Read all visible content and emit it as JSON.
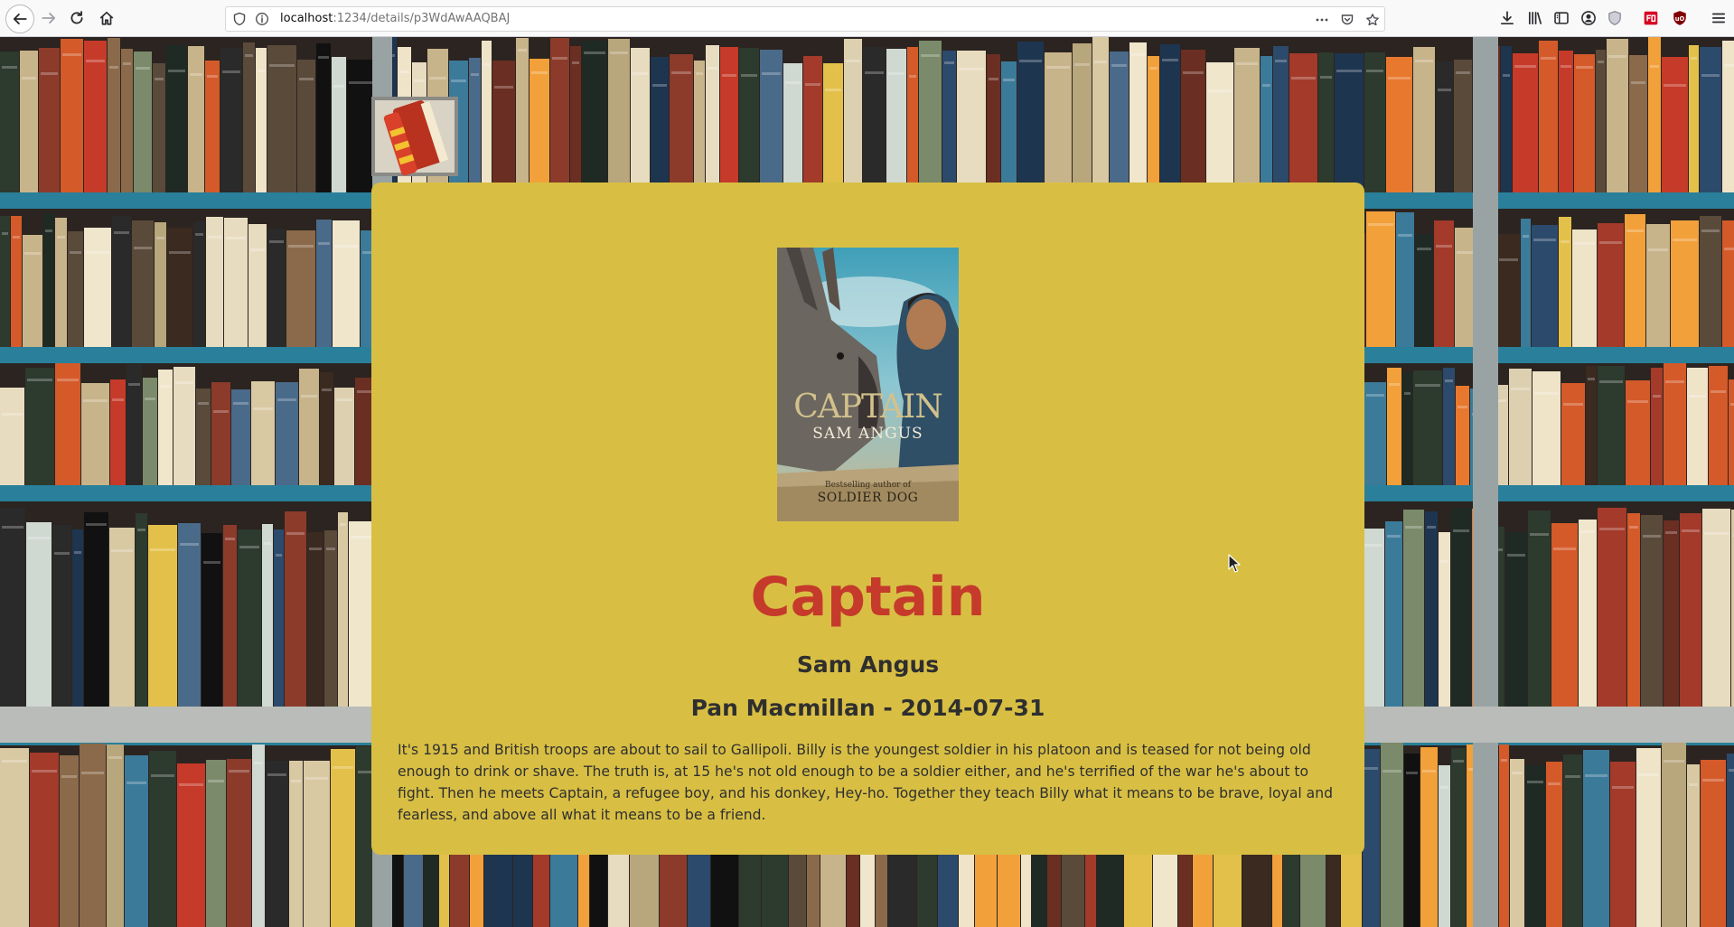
{
  "browser": {
    "url_host": "localhost",
    "url_path": ":1234/details/p3WdAwAAQBAJ",
    "icons": [
      "back-arrow-icon",
      "forward-arrow-icon",
      "reload-icon",
      "home-icon",
      "shield-icon",
      "info-icon",
      "more-icon",
      "pocket-icon",
      "bookmark-star-icon",
      "download-icon",
      "library-icon",
      "sidebar-icon",
      "account-icon",
      "privacy-icon",
      "extension-icon",
      "ublock-icon",
      "menu-icon"
    ]
  },
  "book": {
    "title": "Captain",
    "author": "Sam Angus",
    "publisher_date": "Pan Macmillan - 2014-07-31",
    "description": "It's 1915 and British troops are about to sail to Gallipoli. Billy is the youngest soldier in his platoon and is teased for not being old enough to drink or shave. The truth is, at 15 he's not old enough to be a soldier either, and he's terrified of the war he's about to fight. Then he meets Captain, a refugee boy, and his donkey, Hey-ho. Together they teach Billy what it means to be brave, loyal and fearless, and above all what it means to be a friend.",
    "cover": {
      "title": "CAPTAIN",
      "author": "SAM ANGUS",
      "tagline": "Bestselling author of",
      "other_title": "SOLDIER DOG"
    }
  },
  "colors": {
    "card": "#d8bf44",
    "title": "#c53a2b",
    "text": "#2f2f2f",
    "shelf": "#2a7f9a"
  }
}
